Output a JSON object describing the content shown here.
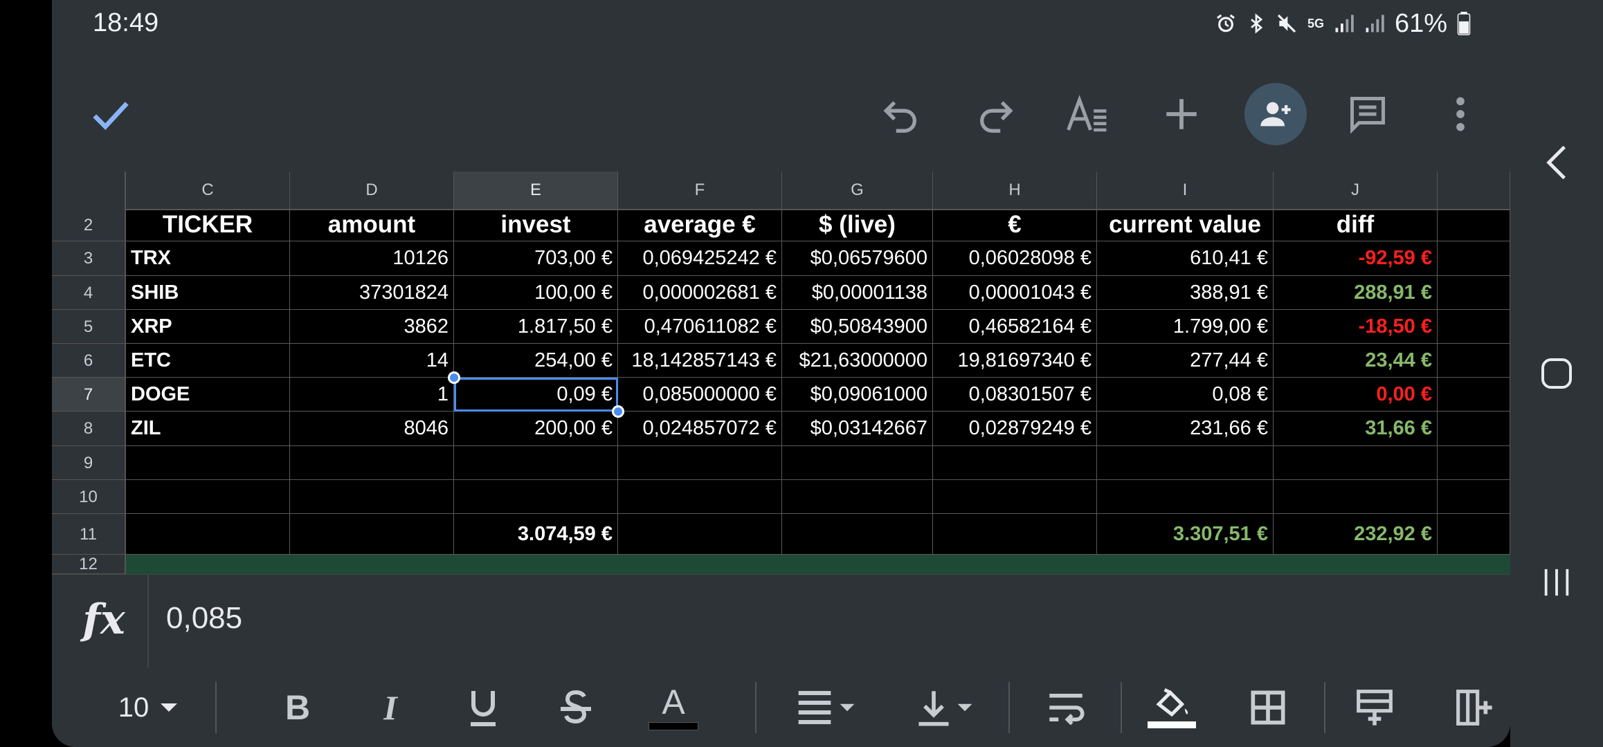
{
  "status_bar": {
    "time": "18:49",
    "network": "5G",
    "battery": "61%"
  },
  "toolbar": {
    "icons": [
      "check-icon",
      "undo-icon",
      "redo-icon",
      "text-format-icon",
      "add-icon",
      "share-person-icon",
      "comment-icon",
      "more-vert-icon"
    ]
  },
  "columns": [
    "C",
    "D",
    "E",
    "F",
    "G",
    "H",
    "I",
    "J"
  ],
  "selected_column": "E",
  "rows": [
    {
      "num": "2",
      "cells": [
        "TICKER",
        "amount",
        "invest",
        "average €",
        "$ (live)",
        "€",
        "current value",
        "diff"
      ]
    },
    {
      "num": "3",
      "cells": [
        "TRX",
        "10126",
        "703,00 €",
        "0,069425242 €",
        "$0,06579600",
        "0,06028098 €",
        "610,41 €",
        "-92,59 €"
      ]
    },
    {
      "num": "4",
      "cells": [
        "SHIB",
        "37301824",
        "100,00 €",
        "0,000002681 €",
        "$0,00001138",
        "0,00001043 €",
        "388,91 €",
        "288,91 €"
      ]
    },
    {
      "num": "5",
      "cells": [
        "XRP",
        "3862",
        "1.817,50 €",
        "0,470611082 €",
        "$0,50843900",
        "0,46582164 €",
        "1.799,00 €",
        "-18,50 €"
      ]
    },
    {
      "num": "6",
      "cells": [
        "ETC",
        "14",
        "254,00 €",
        "18,142857143 €",
        "$21,63000000",
        "19,81697340 €",
        "277,44 €",
        "23,44 €"
      ]
    },
    {
      "num": "7",
      "cells": [
        "DOGE",
        "1",
        "0,09 €",
        "0,085000000 €",
        "$0,09061000",
        "0,08301507 €",
        "0,08 €",
        "0,00 €"
      ]
    },
    {
      "num": "8",
      "cells": [
        "ZIL",
        "8046",
        "200,00 €",
        "0,024857072 €",
        "$0,03142667",
        "0,02879249 €",
        "231,66 €",
        "31,66 €"
      ]
    },
    {
      "num": "9",
      "cells": [
        "",
        "",
        "",
        "",
        "",
        "",
        "",
        ""
      ]
    },
    {
      "num": "10",
      "cells": [
        "",
        "",
        "",
        "",
        "",
        "",
        "",
        ""
      ]
    },
    {
      "num": "11",
      "cells": [
        "",
        "",
        "3.074,59 €",
        "",
        "",
        "",
        "3.307,51 €",
        "232,92 €"
      ]
    },
    {
      "num": "12",
      "cells": [
        "",
        "",
        "",
        "",
        "",
        "",
        "",
        ""
      ]
    }
  ],
  "diff_colors": {
    "negative": "#ff1f1f",
    "positive": "#86b96b"
  },
  "selected_cell": "E7",
  "formula_bar": {
    "label": "fx",
    "value": "0,085"
  },
  "format_toolbar": {
    "font_size": "10",
    "icons": [
      "bold-icon",
      "italic-icon",
      "underline-icon",
      "strikethrough-icon",
      "text-color-icon",
      "horizontal-align-icon",
      "vertical-align-icon",
      "text-wrap-icon",
      "fill-color-icon",
      "borders-icon",
      "insert-row-icon",
      "insert-column-icon"
    ]
  }
}
